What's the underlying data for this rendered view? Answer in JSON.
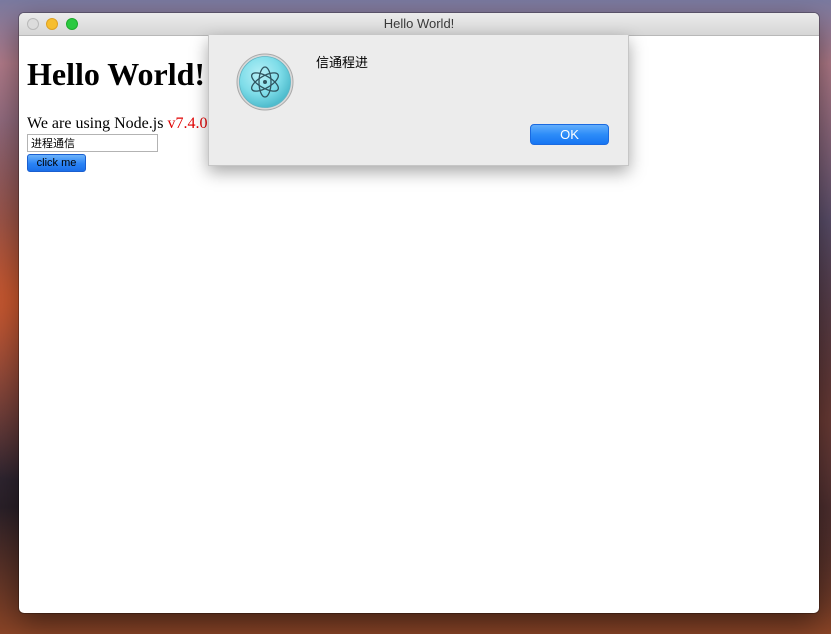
{
  "window": {
    "title": "Hello World!"
  },
  "page": {
    "heading": "Hello World!",
    "node_prefix": "We are using Node.js",
    "node_version": "v7.4.0",
    "input_value": "进程通信",
    "button_label": "click me"
  },
  "dialog": {
    "icon": "electron-logo-icon",
    "message": "信通程进",
    "ok_label": "OK"
  },
  "colors": {
    "version_text": "#e00000",
    "accent_blue": "#2d8cf8",
    "electron_icon": "#7fdde9"
  }
}
